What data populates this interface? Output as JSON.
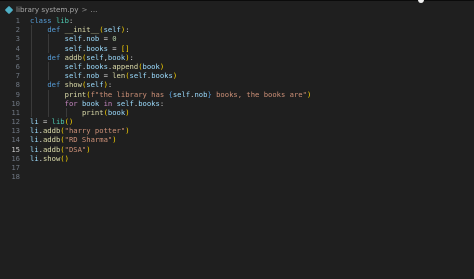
{
  "breadcrumb": {
    "file": "library system.py",
    "separator": ">",
    "trail": "..."
  },
  "editor": {
    "language": "python",
    "current_line": 15,
    "line_numbers": [
      "1",
      "2",
      "3",
      "4",
      "5",
      "6",
      "7",
      "8",
      "9",
      "10",
      "11",
      "12",
      "13",
      "14",
      "15",
      "16",
      "17",
      "18"
    ],
    "lines": [
      [
        {
          "t": "class",
          "c": "kw"
        },
        {
          "t": " "
        },
        {
          "t": "lib",
          "c": "cls"
        },
        {
          "t": ":",
          "c": "pn"
        }
      ],
      [
        {
          "t": "    "
        },
        {
          "t": "def",
          "c": "kw"
        },
        {
          "t": " "
        },
        {
          "t": "__init__",
          "c": "fn"
        },
        {
          "t": "(",
          "c": "br1"
        },
        {
          "t": "self",
          "c": "vr"
        },
        {
          "t": ")",
          "c": "br1"
        },
        {
          "t": ":",
          "c": "pn"
        }
      ],
      [
        {
          "t": "        "
        },
        {
          "t": "self",
          "c": "vr"
        },
        {
          "t": ".",
          "c": "pn"
        },
        {
          "t": "nob",
          "c": "vr"
        },
        {
          "t": " = ",
          "c": "pn"
        },
        {
          "t": "0",
          "c": "num"
        }
      ],
      [
        {
          "t": "        "
        },
        {
          "t": "self",
          "c": "vr"
        },
        {
          "t": ".",
          "c": "pn"
        },
        {
          "t": "books",
          "c": "vr"
        },
        {
          "t": " = ",
          "c": "pn"
        },
        {
          "t": "[]",
          "c": "br1"
        }
      ],
      [
        {
          "t": "    "
        },
        {
          "t": "def",
          "c": "kw"
        },
        {
          "t": " "
        },
        {
          "t": "addb",
          "c": "fn"
        },
        {
          "t": "(",
          "c": "br1"
        },
        {
          "t": "self",
          "c": "vr"
        },
        {
          "t": ",",
          "c": "pn"
        },
        {
          "t": "book",
          "c": "vr"
        },
        {
          "t": ")",
          "c": "br1"
        },
        {
          "t": ":",
          "c": "pn"
        }
      ],
      [
        {
          "t": "        "
        },
        {
          "t": "self",
          "c": "vr"
        },
        {
          "t": ".",
          "c": "pn"
        },
        {
          "t": "books",
          "c": "vr"
        },
        {
          "t": ".",
          "c": "pn"
        },
        {
          "t": "append",
          "c": "fn"
        },
        {
          "t": "(",
          "c": "br1"
        },
        {
          "t": "book",
          "c": "vr"
        },
        {
          "t": ")",
          "c": "br1"
        }
      ],
      [
        {
          "t": "        "
        },
        {
          "t": "self",
          "c": "vr"
        },
        {
          "t": ".",
          "c": "pn"
        },
        {
          "t": "nob",
          "c": "vr"
        },
        {
          "t": " = ",
          "c": "pn"
        },
        {
          "t": "len",
          "c": "fn"
        },
        {
          "t": "(",
          "c": "br1"
        },
        {
          "t": "self",
          "c": "vr"
        },
        {
          "t": ".",
          "c": "pn"
        },
        {
          "t": "books",
          "c": "vr"
        },
        {
          "t": ")",
          "c": "br1"
        }
      ],
      [
        {
          "t": "    "
        },
        {
          "t": "def",
          "c": "kw"
        },
        {
          "t": " "
        },
        {
          "t": "show",
          "c": "fn"
        },
        {
          "t": "(",
          "c": "br1"
        },
        {
          "t": "self",
          "c": "vr"
        },
        {
          "t": ")",
          "c": "br1"
        },
        {
          "t": ":",
          "c": "pn"
        }
      ],
      [
        {
          "t": "        "
        },
        {
          "t": "print",
          "c": "fn"
        },
        {
          "t": "(",
          "c": "br1"
        },
        {
          "t": "f\"the library has ",
          "c": "str"
        },
        {
          "t": "{",
          "c": "kw"
        },
        {
          "t": "self",
          "c": "vr"
        },
        {
          "t": ".",
          "c": "pn"
        },
        {
          "t": "nob",
          "c": "vr"
        },
        {
          "t": "}",
          "c": "kw"
        },
        {
          "t": " books, the books are\"",
          "c": "str"
        },
        {
          "t": ")",
          "c": "br1"
        }
      ],
      [
        {
          "t": "        "
        },
        {
          "t": "for",
          "c": "ctl"
        },
        {
          "t": " "
        },
        {
          "t": "book",
          "c": "vr"
        },
        {
          "t": " "
        },
        {
          "t": "in",
          "c": "ctl"
        },
        {
          "t": " "
        },
        {
          "t": "self",
          "c": "vr"
        },
        {
          "t": ".",
          "c": "pn"
        },
        {
          "t": "books",
          "c": "vr"
        },
        {
          "t": ":",
          "c": "pn"
        }
      ],
      [
        {
          "t": "            "
        },
        {
          "t": "print",
          "c": "fn"
        },
        {
          "t": "(",
          "c": "br1"
        },
        {
          "t": "book",
          "c": "vr"
        },
        {
          "t": ")",
          "c": "br1"
        }
      ],
      [
        {
          "t": "li",
          "c": "vr"
        },
        {
          "t": " = ",
          "c": "pn"
        },
        {
          "t": "lib",
          "c": "cls"
        },
        {
          "t": "()",
          "c": "br1"
        }
      ],
      [
        {
          "t": "li",
          "c": "vr"
        },
        {
          "t": ".",
          "c": "pn"
        },
        {
          "t": "addb",
          "c": "fn"
        },
        {
          "t": "(",
          "c": "br1"
        },
        {
          "t": "\"harry potter\"",
          "c": "str"
        },
        {
          "t": ")",
          "c": "br1"
        }
      ],
      [
        {
          "t": "li",
          "c": "vr"
        },
        {
          "t": ".",
          "c": "pn"
        },
        {
          "t": "addb",
          "c": "fn"
        },
        {
          "t": "(",
          "c": "br1"
        },
        {
          "t": "\"RD Sharma\"",
          "c": "str"
        },
        {
          "t": ")",
          "c": "br1"
        }
      ],
      [
        {
          "t": "li",
          "c": "vr"
        },
        {
          "t": ".",
          "c": "pn"
        },
        {
          "t": "addb",
          "c": "fn"
        },
        {
          "t": "(",
          "c": "br1"
        },
        {
          "t": "\"DSA\"",
          "c": "str"
        },
        {
          "t": ")",
          "c": "br1"
        }
      ],
      [
        {
          "t": "li",
          "c": "vr"
        },
        {
          "t": ".",
          "c": "pn"
        },
        {
          "t": "show",
          "c": "fn"
        },
        {
          "t": "()",
          "c": "br1"
        }
      ],
      [],
      []
    ]
  },
  "colors": {
    "background": "#1f1f1f",
    "keyword": "#569cd6",
    "control": "#c586c0",
    "class": "#4ec9b0",
    "function": "#dcdcaa",
    "variable": "#9cdcfe",
    "string": "#ce9178",
    "number": "#b5cea8",
    "bracket": "#ffd700"
  },
  "icons": {
    "file_icon": "python-file-icon"
  }
}
